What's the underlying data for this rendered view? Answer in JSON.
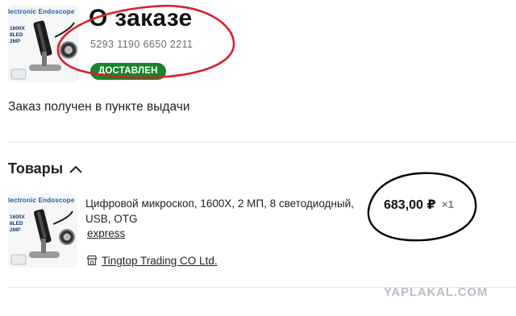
{
  "header": {
    "title": "О заказе",
    "order_number": "5293 1190 6650 2211",
    "status": "ДОСТАВЛЕН"
  },
  "order": {
    "received_text": "Заказ получен в пункте выдачи"
  },
  "products_section": {
    "title": "Товары"
  },
  "product_thumb": {
    "brand_text": "lectronic Endoscope",
    "spec_text": "1600X\n8LED\n2MP"
  },
  "product": {
    "name": "Цифровой микроскоп, 1600X, 2 МП, 8 светодиодный, USB, OTG",
    "delivery": "express",
    "store": "Tingtop Trading CO Ltd.",
    "price": "683,00 ₽",
    "quantity": "×1"
  },
  "watermark": "YAPLAKAL.COM",
  "colors": {
    "status_green": "#15842a",
    "annotation_red": "#d8202a",
    "annotation_black": "#000000"
  }
}
